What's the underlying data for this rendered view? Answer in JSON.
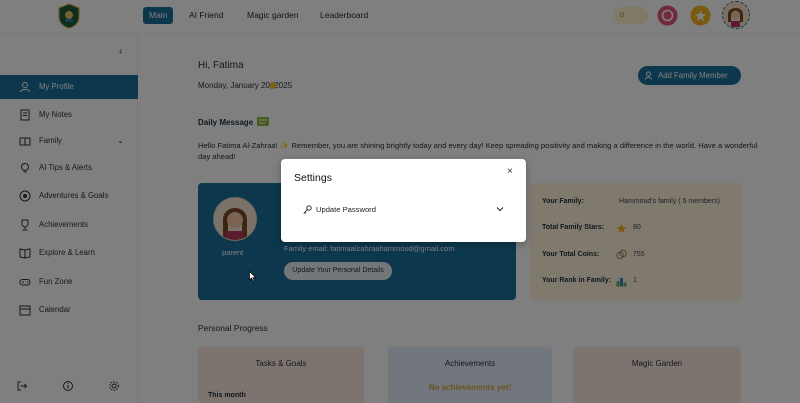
{
  "topnav": {
    "tabs": [
      {
        "label": "Main",
        "active": true
      },
      {
        "label": "AI Friend"
      },
      {
        "label": "Magic garden"
      },
      {
        "label": "Leaderboard"
      }
    ],
    "coins_badge": "0"
  },
  "sidebar": {
    "items": [
      {
        "label": "My Profile",
        "icon": "person-icon",
        "active": true
      },
      {
        "label": "My Notes",
        "icon": "notes-icon"
      },
      {
        "label": "Family",
        "icon": "family-icon",
        "expandable": true
      },
      {
        "label": "AI Tips & Alerts",
        "icon": "bulb-icon"
      },
      {
        "label": "Adventures & Goals",
        "icon": "target-icon"
      },
      {
        "label": "Achievements",
        "icon": "trophy-icon"
      },
      {
        "label": "Explore & Learn",
        "icon": "book-icon"
      },
      {
        "label": "Fun Zone",
        "icon": "gamepad-icon"
      },
      {
        "label": "Calendar",
        "icon": "calendar-icon"
      }
    ]
  },
  "main": {
    "greeting": "Hi, Fatima",
    "date": "Monday, January 20, 2025",
    "add_member_label": "Add Family Member",
    "daily_message_title": "Daily Message",
    "daily_message_text": "Hello Fatima Al-Zahraa! ✨ Remember, you are shining brightly today and every day! Keep spreading positivity and making a difference in the world. Have a wonderful day ahead!",
    "profile": {
      "role": "parent",
      "email": "Family email: fatimaalzahraahammoud@gmail.com",
      "update_label": "Update Your Personal Details"
    },
    "family_stats": [
      {
        "label": "Your Family:",
        "value": "Hammoud's family ( 5 members)"
      },
      {
        "label": "Total Family Stars:",
        "value": "80"
      },
      {
        "label": "Your Total Coins:",
        "value": "755"
      },
      {
        "label": "Your Rank in Family:",
        "value": "1"
      }
    ],
    "personal_progress_title": "Personal Progress",
    "progress_cards": [
      {
        "title": "Tasks & Goals",
        "subtitle": "This month"
      },
      {
        "title": "Achievements",
        "empty_text": "No achievements yet!"
      },
      {
        "title": "Magic Garden"
      }
    ]
  },
  "settings_modal": {
    "title": "Settings",
    "close_glyph": "×",
    "row_label": "Update Password"
  },
  "colors": {
    "primary": "#1b6f9a",
    "family_card_bg": "#fff3dc",
    "overlay": "rgba(0,0,0,0.5)"
  }
}
